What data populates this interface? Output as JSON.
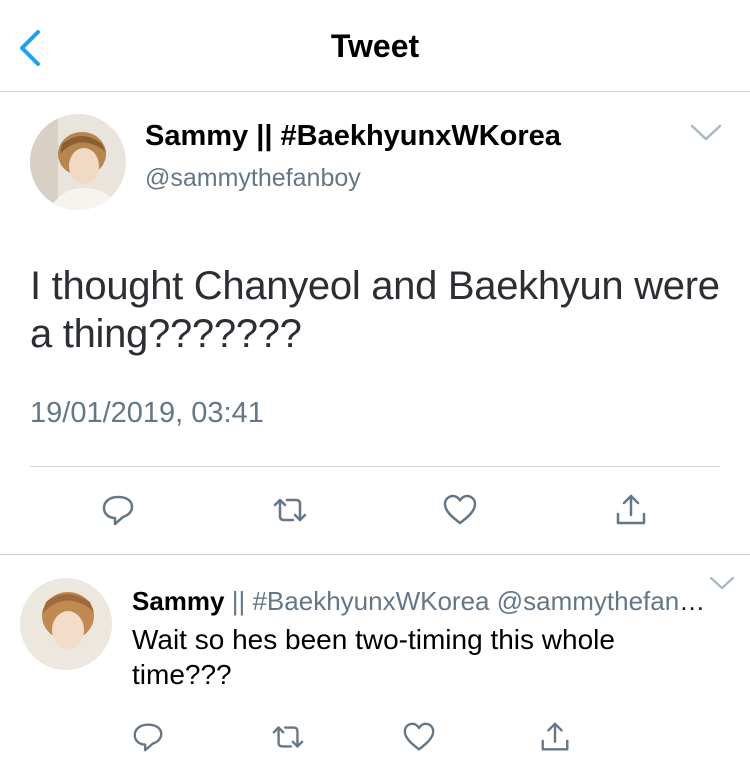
{
  "nav": {
    "title": "Tweet",
    "back_icon": "chevron-left-icon",
    "accent_color": "#1da1f2"
  },
  "main_tweet": {
    "display_name": "Sammy || #BaekhyunxWKorea",
    "handle": "@sammythefanboy",
    "text": "I thought Chanyeol and Baekhyun were a thing???????",
    "timestamp": "19/01/2019, 03:41",
    "actions": [
      "reply-icon",
      "retweet-icon",
      "like-icon",
      "share-icon"
    ]
  },
  "reply": {
    "display_name": "Sammy",
    "meta": "|| #BaekhyunxWKorea @sammythefanb...",
    "text": "Wait so hes been two-timing this whole time???",
    "actions": [
      "reply-icon",
      "retweet-icon",
      "like-icon",
      "share-icon"
    ]
  },
  "colors": {
    "icon_gray": "#657786",
    "text_dark": "#14171a",
    "divider": "#cfd4d8"
  }
}
